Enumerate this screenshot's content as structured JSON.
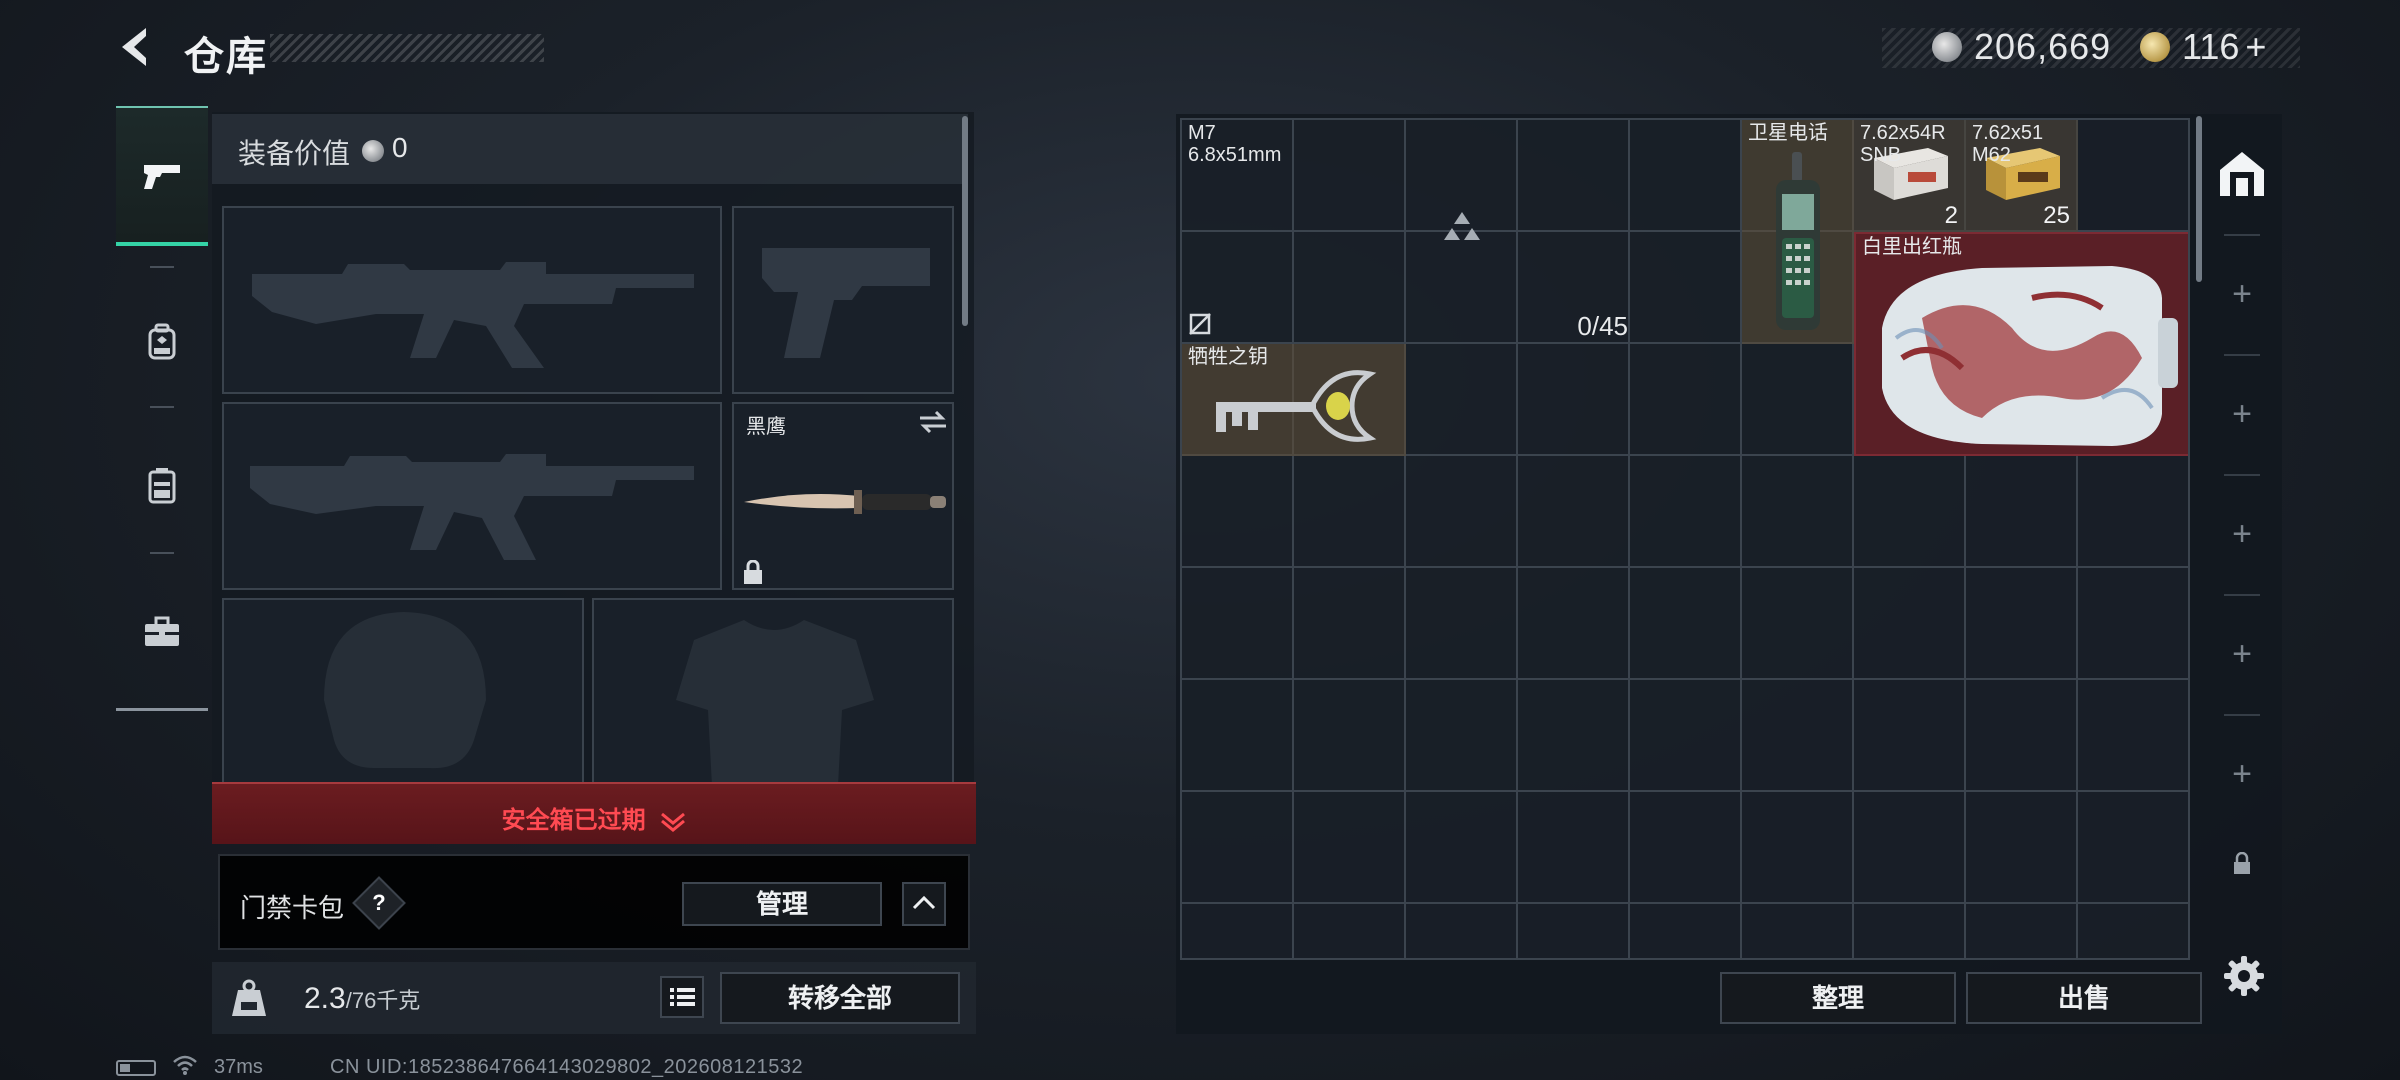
{
  "header": {
    "title": "仓库",
    "currency": {
      "silver": "206,669",
      "gold": "116",
      "gold_add": "+"
    }
  },
  "side_tabs": [
    {
      "name": "weapons",
      "icon": "pistol-icon",
      "active": true
    },
    {
      "name": "gear",
      "icon": "backpack-icon",
      "active": false
    },
    {
      "name": "chest-rig",
      "icon": "rig-icon",
      "active": false
    },
    {
      "name": "case",
      "icon": "briefcase-icon",
      "active": false
    }
  ],
  "equipment": {
    "value_label": "装备价值",
    "value": "0",
    "melee_name": "黑鹰",
    "safe_box_text": "安全箱已过期",
    "keycard_label": "门禁卡包",
    "keycard_help": "?",
    "manage_label": "管理"
  },
  "weight": {
    "current": "2.3",
    "total": "/76千克",
    "transfer_all": "转移全部"
  },
  "storage": {
    "items": [
      {
        "id": "m7",
        "name": "M7",
        "caliber": "6.8x51mm",
        "count": "0/45",
        "level_icon": "triangle-rank-icon"
      },
      {
        "id": "sat-phone",
        "name": "卫星电话"
      },
      {
        "id": "ammo-1",
        "name": "7.62x54R",
        "sub": "SNB",
        "qty": "2"
      },
      {
        "id": "ammo-2",
        "name": "7.62x51",
        "sub": "M62",
        "qty": "25"
      },
      {
        "id": "vase",
        "name": "白里出红瓶"
      },
      {
        "id": "key",
        "name": "牺牲之钥"
      }
    ],
    "sort_label": "整理",
    "sell_label": "出售"
  },
  "status": {
    "ping": "37ms",
    "uid": "CN UID:18523864766414302980​2_202608121532"
  },
  "colors": {
    "accent": "#34d3a6",
    "alert": "#ff4a52",
    "alert_bg": "#5a161b",
    "vase_bg": "#5a1f26"
  }
}
